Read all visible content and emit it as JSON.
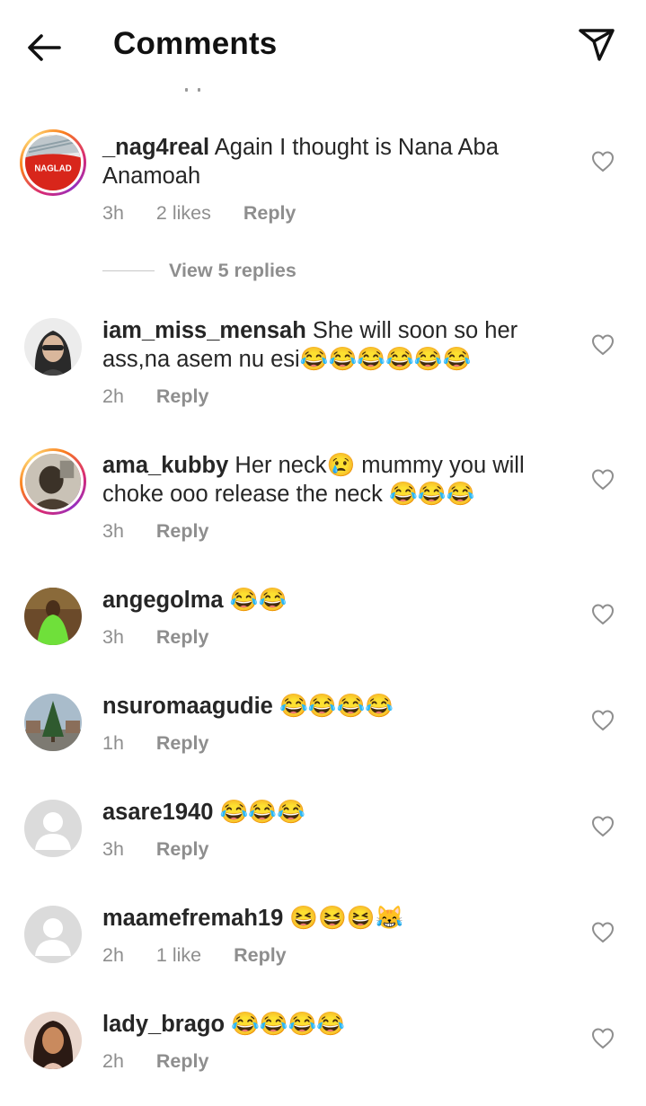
{
  "header": {
    "title": "Comments",
    "back_icon": "arrow-left-icon",
    "send_icon": "paper-plane-icon"
  },
  "comments": [
    {
      "username": "_nag4real",
      "text": "Again I thought is Nana Aba Anamoah",
      "time": "3h",
      "likes": "2 likes",
      "reply": "Reply",
      "avatar_text": "NAGLAD",
      "avatar_colors": [
        "#d8261b",
        "#e8e8e8"
      ],
      "story_ring": true
    },
    {
      "username": "iam_miss_mensah",
      "text": "She will soon so her ass,na asem nu esi😂😂😂😂😂😂",
      "time": "2h",
      "likes": "",
      "reply": "Reply",
      "avatar_colors": [
        "#5a5a5a",
        "#d9b79c"
      ],
      "story_ring": false
    },
    {
      "username": "ama_kubby",
      "text": "Her neck😢 mummy you will choke ooo release the neck 😂😂😂",
      "time": "3h",
      "likes": "",
      "reply": "Reply",
      "avatar_colors": [
        "#3b3228",
        "#c9c2b6"
      ],
      "story_ring": true
    },
    {
      "username": "angegolma",
      "text": "😂😂",
      "time": "3h",
      "likes": "",
      "reply": "Reply",
      "avatar_colors": [
        "#5b3a1e",
        "#6fe03a"
      ],
      "story_ring": false
    },
    {
      "username": "nsuromaagudie",
      "text": "😂😂😂😂",
      "time": "1h",
      "likes": "",
      "reply": "Reply",
      "avatar_colors": [
        "#8aa4b8",
        "#2f5a2f"
      ],
      "story_ring": false
    },
    {
      "username": "asare1940",
      "text": "😂😂😂",
      "time": "3h",
      "likes": "",
      "reply": "Reply",
      "avatar_colors": [
        "#dbdbdb",
        "#ffffff"
      ],
      "story_ring": false
    },
    {
      "username": "maamefremah19",
      "text": "😆😆😆😹",
      "time": "2h",
      "likes": "1 like",
      "reply": "Reply",
      "avatar_colors": [
        "#dbdbdb",
        "#ffffff"
      ],
      "story_ring": false
    },
    {
      "username": "lady_brago",
      "text": "😂😂😂😂",
      "time": "2h",
      "likes": "",
      "reply": "Reply",
      "avatar_colors": [
        "#2b1a14",
        "#c98a5e"
      ],
      "story_ring": false
    }
  ],
  "view_replies": "View 5 replies",
  "heart_icon": "heart-outline-icon",
  "colors": {
    "text": "#262626",
    "muted": "#8e8e8e",
    "ring_gradient": [
      "#d62976",
      "#fa7e1e",
      "#feda75",
      "#962fbf"
    ]
  }
}
